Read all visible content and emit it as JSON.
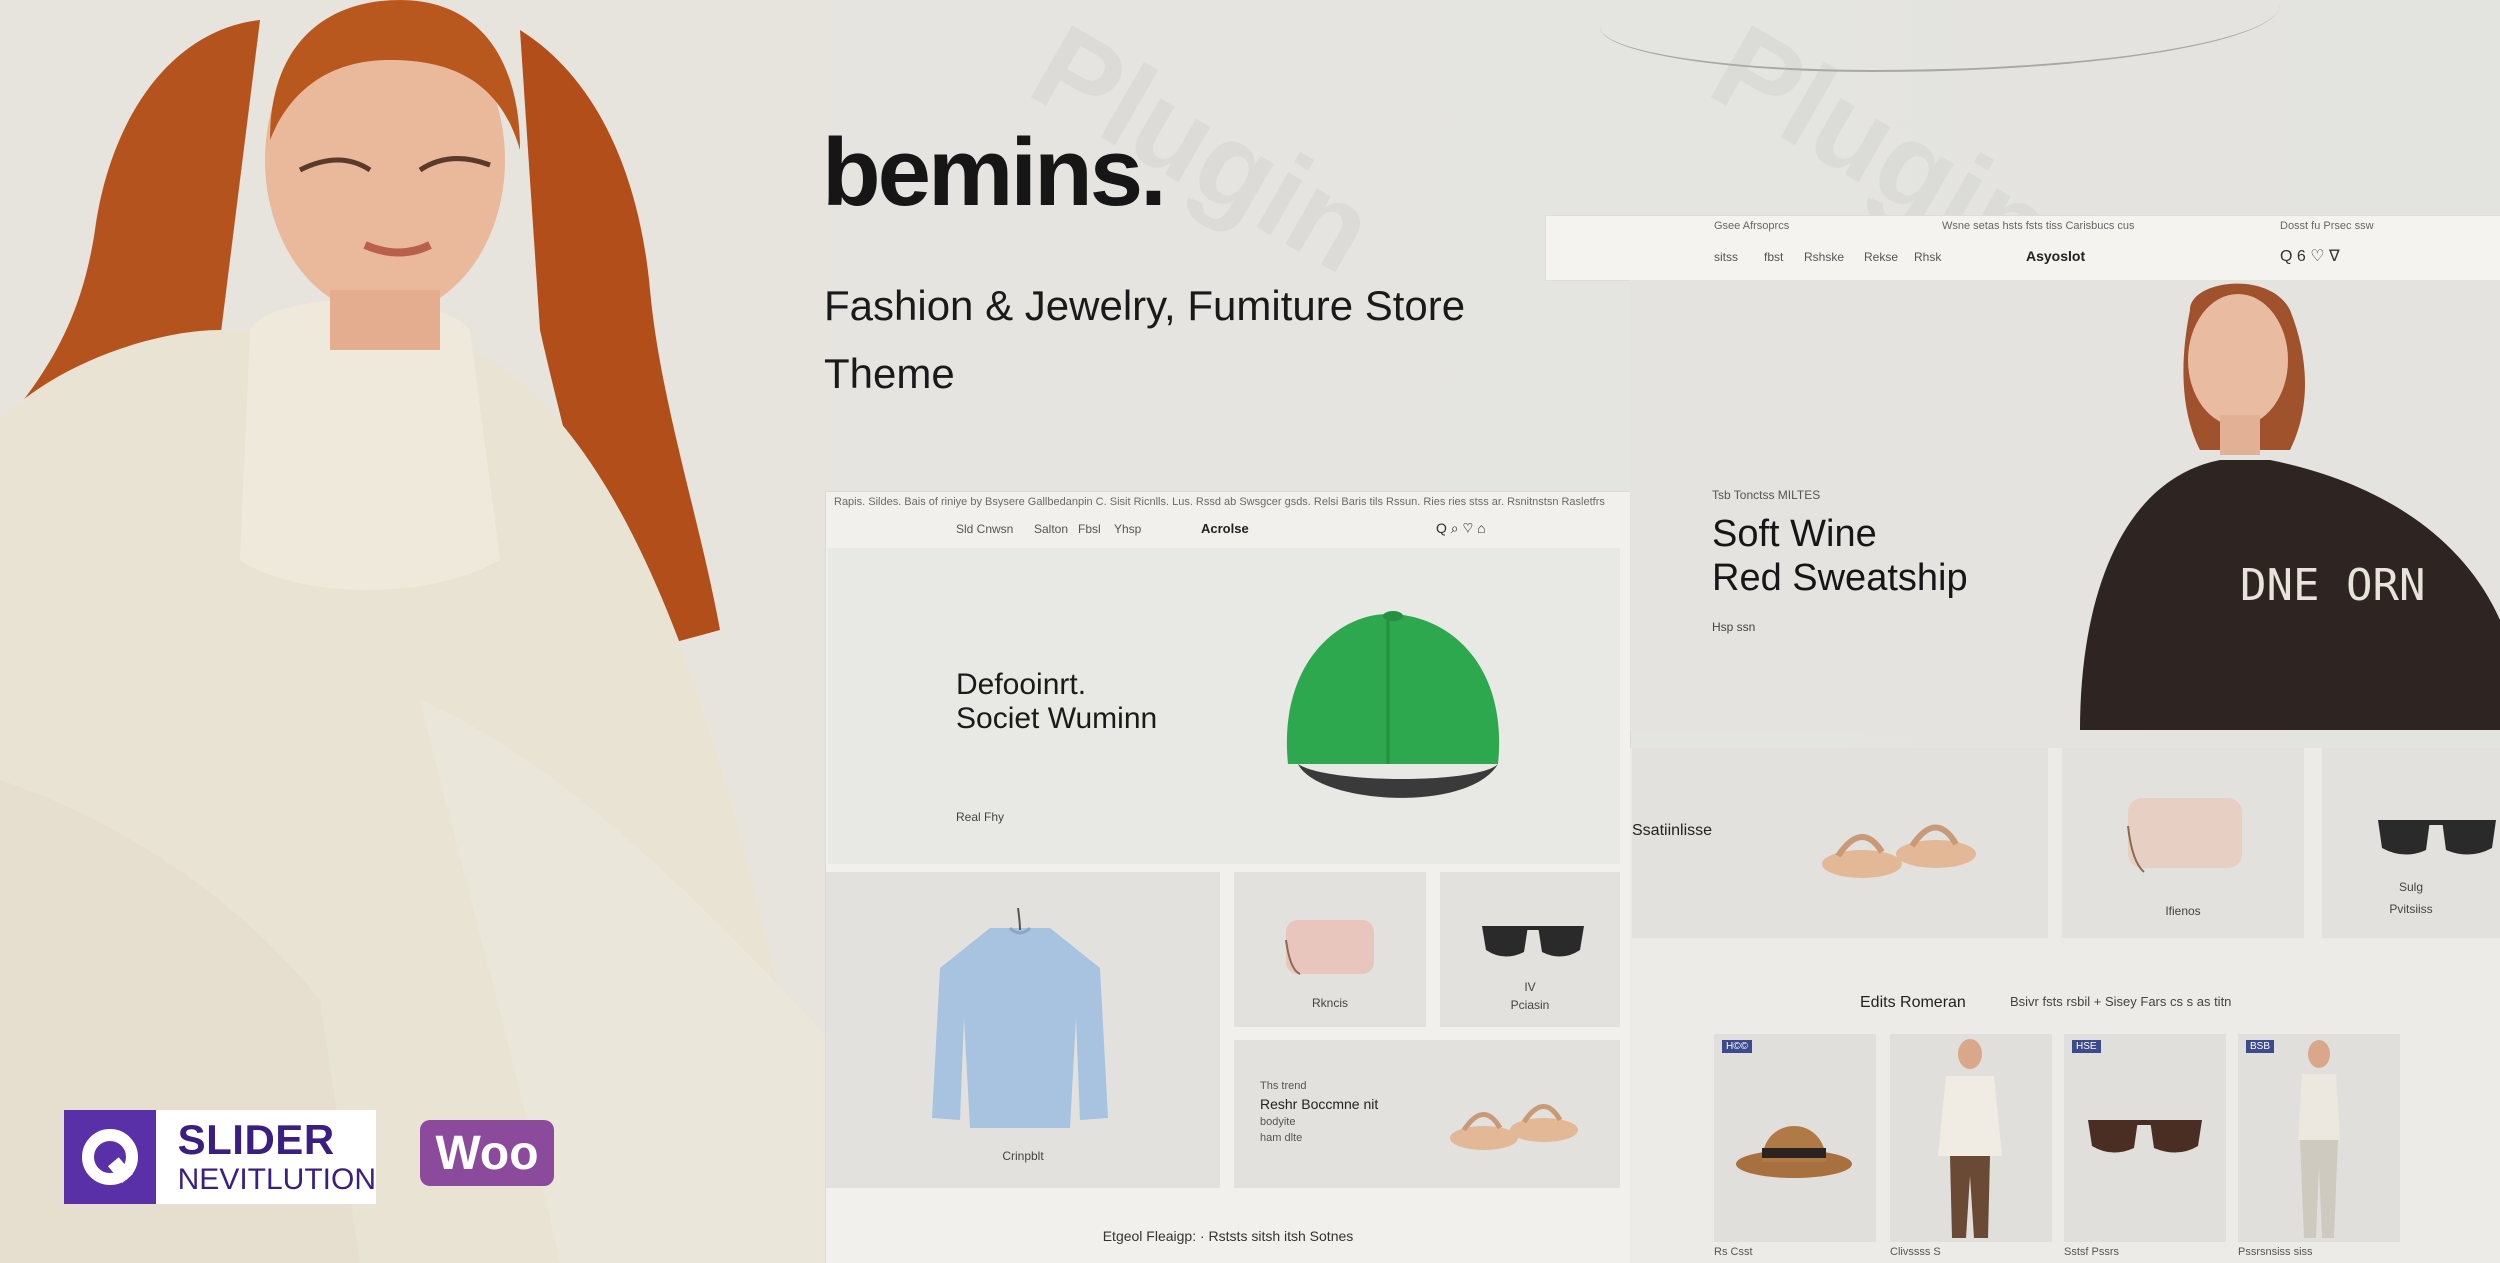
{
  "brand": {
    "name": "bemins.",
    "tagline": "Fashion & Jewelry, Fumiture Store Theme"
  },
  "logos": {
    "slider_revolution": {
      "line1": "SLIDER",
      "line2": "NEVITLUTION"
    },
    "woo": "Woo"
  },
  "watermark": "Plugin",
  "mockup1": {
    "topbar": "Rapis. Sildes. Bais of riniye by Bsysere Gallbedanpin C. Sisit Ricnlls.   Lus. Rssd ab Swsgcer gsds. Relsi Baris tils Rssun. Ries ries stss ar. Rsnitnstsn Rasletfrs",
    "nav": [
      "Sld Cnwsn",
      "Salton",
      "Fbsl",
      "Yhsp"
    ],
    "logo": "Acrolse",
    "icons": "Q ⌕ ♡ ⌂",
    "hero": {
      "title_line1": "Defooinrt.",
      "title_line2": "Societ Wuminn",
      "cta": "Real Fhy"
    },
    "tiles": [
      {
        "label": "Crinpblt"
      },
      {
        "label": "Rkncis"
      },
      {
        "label": "Pciasin",
        "sub": "IV"
      },
      {
        "eyebrow": "Ths trend",
        "title": "Reshr Boccmne nit",
        "line2": "bodyite",
        "line3": "ham dlte"
      }
    ],
    "footer": "Etgeol Fleaigp: ·  Rststs sitsh itsh  Sotnes"
  },
  "mockup2": {
    "topbar_left": "Gsee Afrsoprcs",
    "topbar_center": "Wsne setas hsts fsts tiss Carisbucs cus",
    "topbar_right": "Dosst fu Prsec ssw",
    "nav": [
      "sitss",
      "fbst",
      "Rshske",
      "Rekse",
      "Rhsk"
    ],
    "logo": "Asyoslot",
    "icons": "Q 6 ♡ ∇",
    "hero": {
      "eyebrow": "Tsb Tonctss MILTES",
      "title_line1": "Soft Wine",
      "title_line2": "Red Sweatship",
      "cta": "Hsp ssn"
    },
    "promo_label": "Ssatiinlisse",
    "cat_labels": [
      "Ifienos",
      "Sulg",
      "Pvitsiiss"
    ],
    "editorial": {
      "title": "Edits Romeran",
      "tabs": "Bsivr fsts rsbil  +  Sisey  Fars cs s  as titn"
    },
    "badges": [
      "H©©",
      "HSE",
      "BSB"
    ],
    "product_labels": [
      "Rs Csst",
      "Clivssss S",
      "Sstsf Pssrs",
      "Pssrsnsiss siss"
    ]
  },
  "colors": {
    "accent_green": "#2ea84e",
    "sr_purple": "#5a30a8",
    "woo_purple": "#8b4a9c",
    "badge_blue": "#3d4b8c"
  }
}
